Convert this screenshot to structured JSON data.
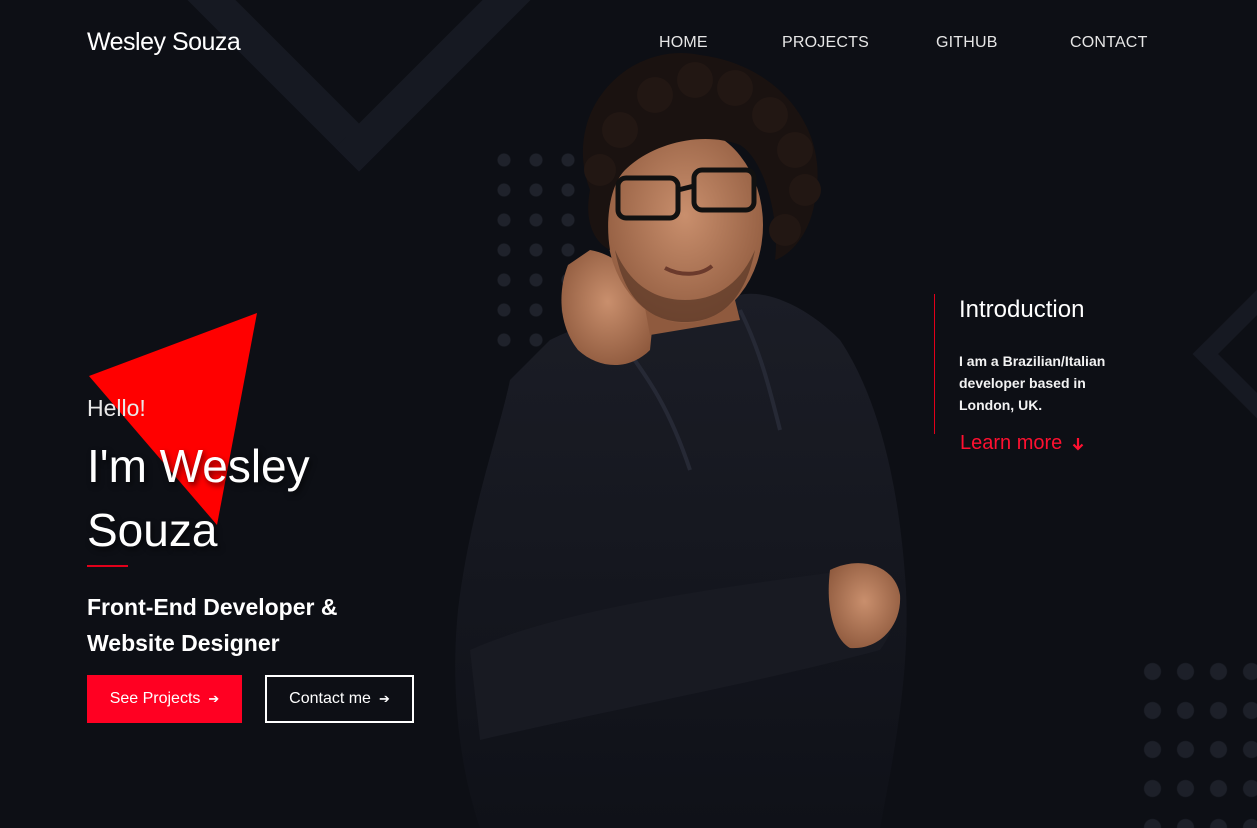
{
  "header": {
    "logo": "Wesley Souza",
    "nav": [
      "HOME",
      "PROJECTS",
      "GITHUB",
      "CONTACT"
    ]
  },
  "hero": {
    "greeting": "Hello!",
    "name_line1": "I'm Wesley",
    "name_line2": "Souza",
    "role_line1": "Front-End Developer &",
    "role_line2": "Website Designer",
    "primary_button": "See Projects",
    "secondary_button": "Contact me"
  },
  "intro": {
    "title": "Introduction",
    "text": "I am a Brazilian/Italian developer based in London, UK.",
    "link": "Learn more"
  },
  "colors": {
    "accent": "#ff0022",
    "background": "#0d0f15"
  },
  "icons": {
    "button_arrow": "arrow-right-icon",
    "learn_more_arrow": "arrow-down-icon"
  }
}
